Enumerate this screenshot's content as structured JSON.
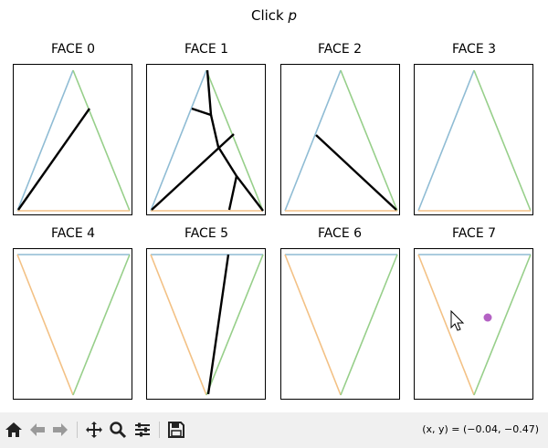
{
  "figure": {
    "suptitle_text": "Click ",
    "suptitle_var": "p",
    "faces": [
      {
        "title": "FACE 0"
      },
      {
        "title": "FACE 1"
      },
      {
        "title": "FACE 2"
      },
      {
        "title": "FACE 3"
      },
      {
        "title": "FACE 4"
      },
      {
        "title": "FACE 5"
      },
      {
        "title": "FACE 6"
      },
      {
        "title": "FACE 7"
      }
    ],
    "edge_colors": {
      "edge_a": "#8fbcd4",
      "edge_b": "#97cf8a",
      "edge_c": "#f3c185",
      "path": "#000000",
      "point": "#b462c4"
    }
  },
  "toolbar": {
    "icons": [
      "home-icon",
      "back-arrow-icon",
      "forward-arrow-icon",
      "pan-icon",
      "zoom-icon",
      "subplots-config-icon",
      "save-icon"
    ],
    "coords_text": "(x, y) = (−0.04, −0.47)"
  }
}
